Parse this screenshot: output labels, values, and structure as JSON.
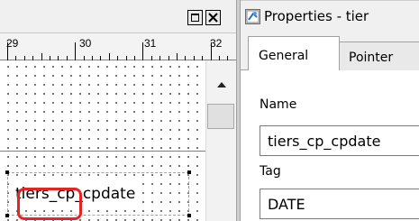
{
  "painter": {
    "ruler_numbers": [
      "29",
      "30",
      "31",
      "32"
    ],
    "field_text": "tiers_cp_cpdate"
  },
  "properties": {
    "title": "Properties - tier",
    "tabs": [
      "General",
      "Pointer"
    ],
    "name_label": "Name",
    "name_value": "tiers_cp_cpdate",
    "tag_label": "Tag",
    "tag_value": "DATE",
    "highlight_color": "#e52424"
  },
  "icons": {
    "maximize": "maximize-icon",
    "close": "close-icon",
    "properties": "properties-icon",
    "scroll_up": "scroll-up-arrow-icon"
  }
}
